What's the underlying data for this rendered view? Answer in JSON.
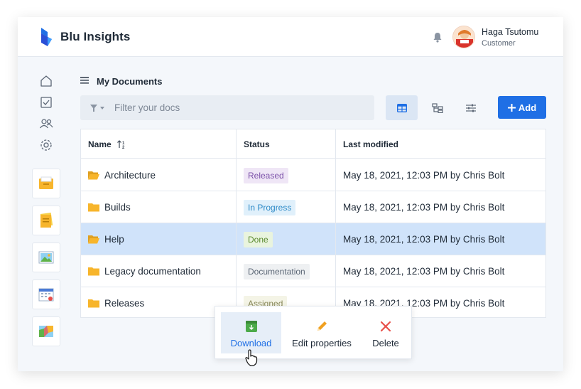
{
  "header": {
    "app_title": "Blu Insights",
    "user_name": "Haga Tsutomu",
    "user_role": "Customer"
  },
  "nav": {
    "icons": [
      "home-icon",
      "tasks-icon",
      "users-icon",
      "settings-icon"
    ]
  },
  "apps": [
    "file-cabinet-app",
    "sticky-notes-app",
    "image-viewer-app",
    "calendar-app",
    "map-app"
  ],
  "page": {
    "title": "My Documents"
  },
  "toolbar": {
    "filter_placeholder": "Filter your docs",
    "add_label": "Add"
  },
  "table": {
    "columns": [
      "Name",
      "Status",
      "Last modified"
    ],
    "rows": [
      {
        "name": "Architecture",
        "status": "Released",
        "modified": "May 18, 2021, 12:03 PM by Chris Bolt",
        "open": true
      },
      {
        "name": "Builds",
        "status": "In Progress",
        "modified": "May 18, 2021, 12:03 PM by Chris Bolt",
        "open": false
      },
      {
        "name": "Help",
        "status": "Done",
        "modified": "May 18, 2021, 12:03 PM by Chris Bolt",
        "open": true,
        "selected": true
      },
      {
        "name": "Legacy documentation",
        "status": "Documentation",
        "modified": "May 18, 2021, 12:03 PM by Chris Bolt",
        "open": false
      },
      {
        "name": "Releases",
        "status": "Assigned",
        "modified": "May 18, 2021, 12:03 PM by Chris Bolt",
        "open": false
      }
    ]
  },
  "status_colors": {
    "Released": {
      "bg": "#efe6f6",
      "fg": "#7a4fa8"
    },
    "In Progress": {
      "bg": "#e0f0fb",
      "fg": "#2d8ac7"
    },
    "Done": {
      "bg": "#e9f4de",
      "fg": "#5a8a2e"
    },
    "Documentation": {
      "bg": "#eef0f2",
      "fg": "#5b6675"
    },
    "Assigned": {
      "bg": "#f4f4e6",
      "fg": "#8a8a5c"
    }
  },
  "context_menu": {
    "download": "Download",
    "edit": "Edit properties",
    "delete": "Delete"
  },
  "colors": {
    "accent": "#1f6fe5",
    "folder": "#f7b52c",
    "delete": "#e8504a",
    "edit": "#f0a020"
  }
}
